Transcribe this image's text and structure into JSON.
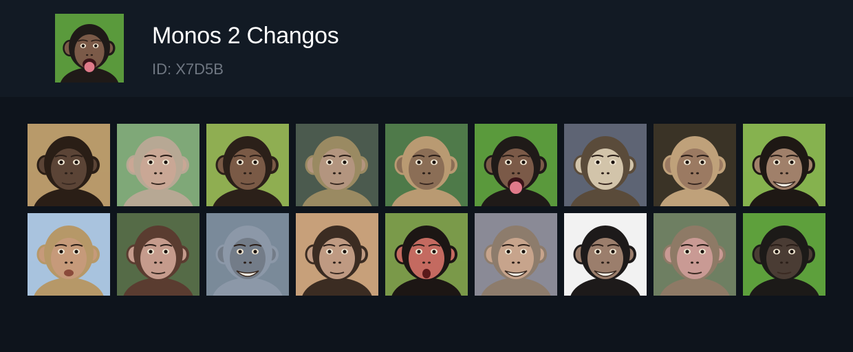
{
  "profile": {
    "name": "Monos 2 Changos",
    "id_label": "ID: X7D5B",
    "avatar_icon": "chimp-tongue-out-avatar"
  },
  "colors": {
    "page_bg": "#0e141c",
    "header_bg": "#121a24",
    "title": "#ffffff",
    "subtitle": "#6f7782"
  },
  "gallery": [
    {
      "icon": "chimp-with-flower",
      "bg": "#b89a6a",
      "fur": "#2a1e16",
      "face": "#5b4436",
      "mouth": "closed"
    },
    {
      "icon": "macaque-waving",
      "bg": "#7fa878",
      "fur": "#b7a894",
      "face": "#c9a795",
      "mouth": "closed"
    },
    {
      "icon": "chimp-thinking",
      "bg": "#8fae52",
      "fur": "#2b2019",
      "face": "#7a5a46",
      "mouth": "closed"
    },
    {
      "icon": "macaque-serious",
      "bg": "#4b5a4e",
      "fur": "#9a8a62",
      "face": "#b3957f",
      "mouth": "closed"
    },
    {
      "icon": "capuchin-sleepy",
      "bg": "#4f7a4a",
      "fur": "#b99a72",
      "face": "#8b6e56",
      "mouth": "closed"
    },
    {
      "icon": "chimp-tongue-out",
      "bg": "#5a9a3c",
      "fur": "#1f1a18",
      "face": "#7b5a48",
      "mouth": "tongue"
    },
    {
      "icon": "capuchin-bearded",
      "bg": "#5e6474",
      "fur": "#5a4b3a",
      "face": "#d2c4aa",
      "mouth": "closed"
    },
    {
      "icon": "capuchin-at-table",
      "bg": "#3a3326",
      "fur": "#bfa17a",
      "face": "#9b7a62",
      "mouth": "closed"
    },
    {
      "icon": "chimp-laughing",
      "bg": "#86b24f",
      "fur": "#1e1814",
      "face": "#a0806a",
      "mouth": "grin"
    },
    {
      "icon": "macaque-kissy-face",
      "bg": "#a9c3de",
      "fur": "#b69868",
      "face": "#c69a7a",
      "mouth": "pout"
    },
    {
      "icon": "young-macaque-staring",
      "bg": "#556b47",
      "fur": "#5a3c30",
      "face": "#c59b8c",
      "mouth": "closed"
    },
    {
      "icon": "gray-monkey-grinning",
      "bg": "#7a8a9a",
      "fur": "#8c98a8",
      "face": "#737c88",
      "mouth": "grin"
    },
    {
      "icon": "young-chimp",
      "bg": "#c7a07a",
      "fur": "#3b2c22",
      "face": "#bf9a82",
      "mouth": "closed"
    },
    {
      "icon": "spider-monkey-surprised",
      "bg": "#7a9a4a",
      "fur": "#1c1614",
      "face": "#c46a60",
      "mouth": "o"
    },
    {
      "icon": "macaque-fangs",
      "bg": "#8a8a96",
      "fur": "#8d7c6c",
      "face": "#c7a48c",
      "mouth": "grin"
    },
    {
      "icon": "chimp-big-smile",
      "bg": "#f2f2f2",
      "fur": "#1d1a1a",
      "face": "#9b7e6c",
      "mouth": "grin"
    },
    {
      "icon": "macaque-wide-eyed",
      "bg": "#6e7f62",
      "fur": "#8e7a66",
      "face": "#c99a94",
      "mouth": "closed"
    },
    {
      "icon": "chimp-raising-hands",
      "bg": "#5ea03c",
      "fur": "#1c1a18",
      "face": "#4a3c34",
      "mouth": "closed"
    }
  ]
}
